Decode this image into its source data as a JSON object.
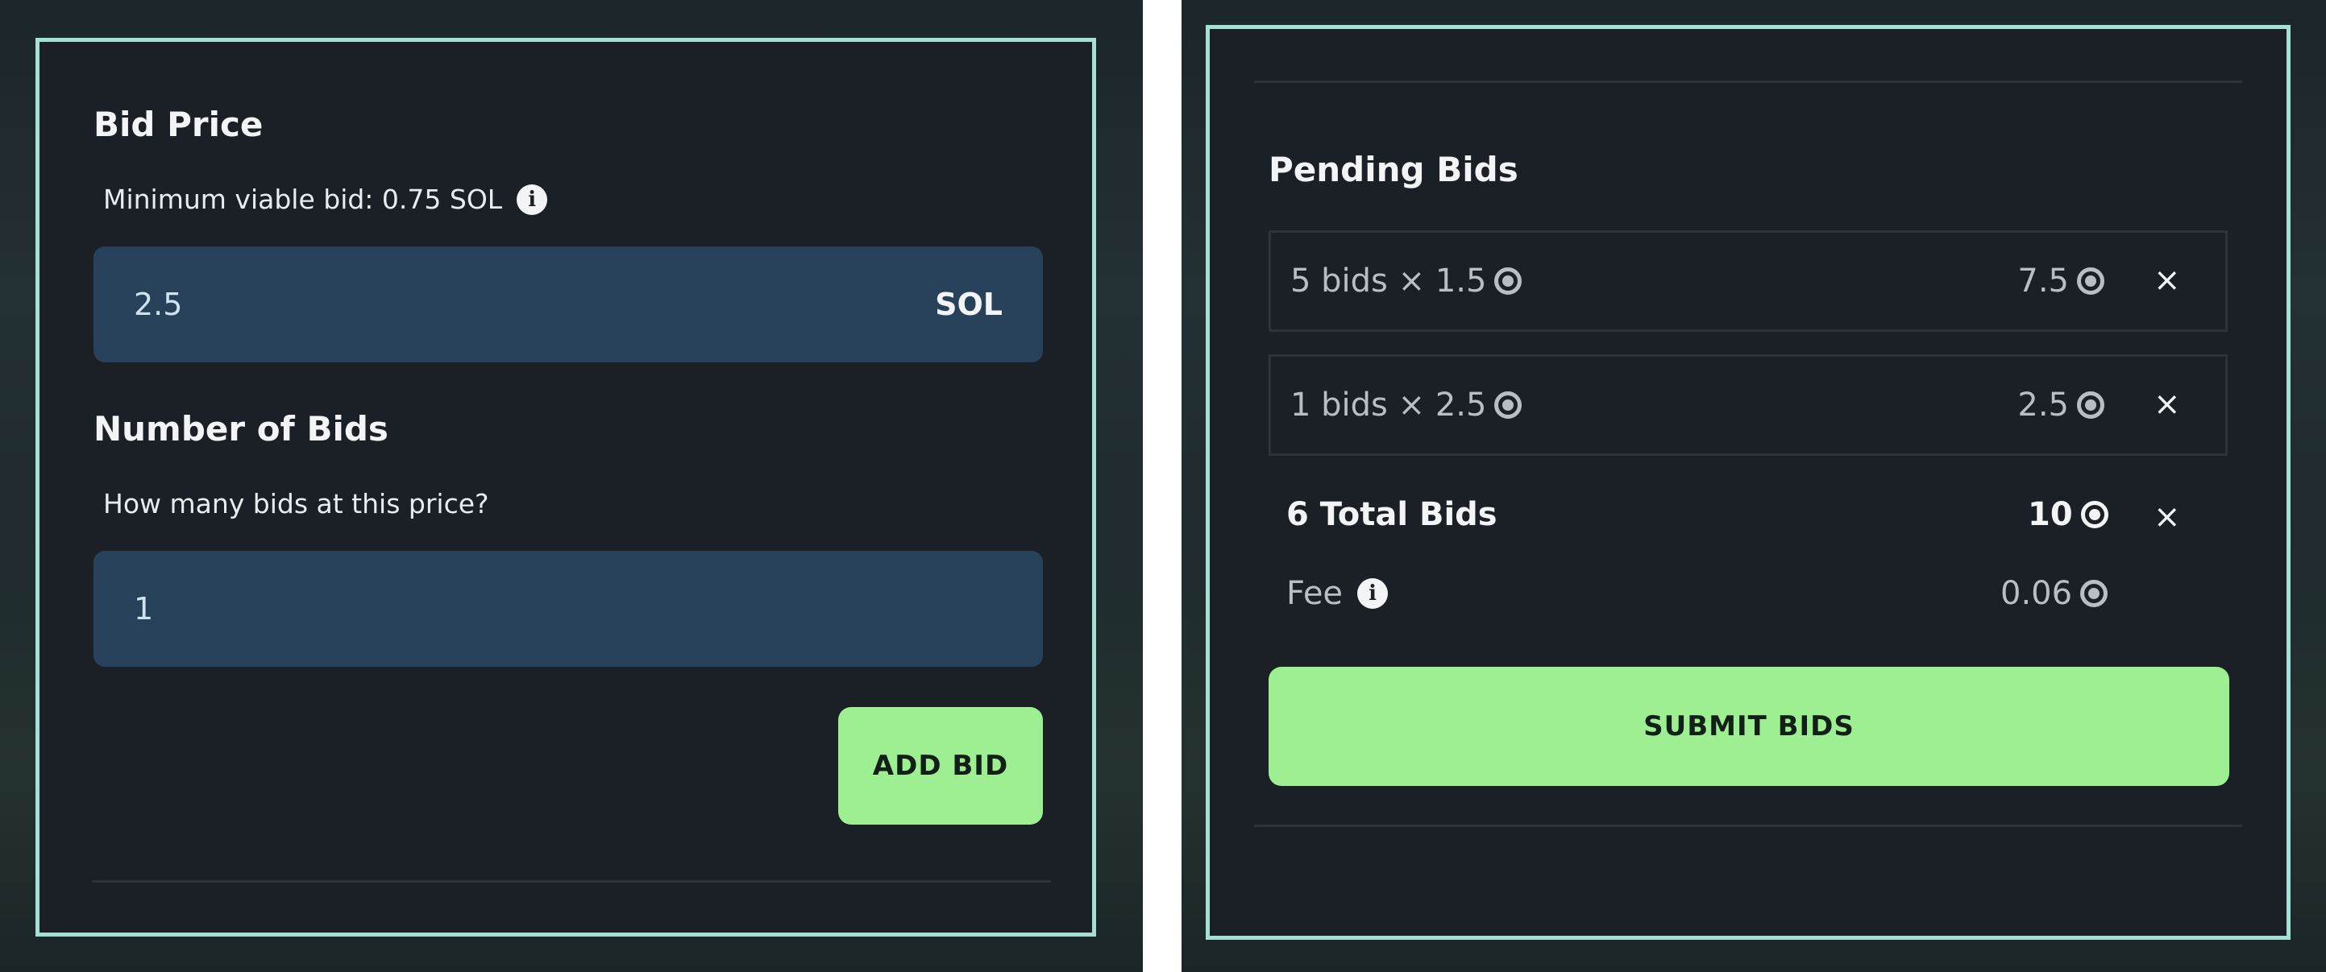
{
  "bid_form": {
    "price_heading": "Bid Price",
    "price_hint": "Minimum viable bid: 0.75 SOL",
    "price_value": "2.5",
    "price_unit": "SOL",
    "count_heading": "Number of Bids",
    "count_hint": "How many bids at this price?",
    "count_value": "1",
    "add_button": "ADD BID"
  },
  "pending": {
    "heading": "Pending Bids",
    "bids": [
      {
        "description": "5 bids × 1.5",
        "amount": "7.5",
        "remove": "×"
      },
      {
        "description": "1 bids × 2.5",
        "amount": "2.5",
        "remove": "×"
      }
    ],
    "total_label": "6 Total Bids",
    "total_amount": "10",
    "total_remove": "×",
    "fee_label": "Fee",
    "fee_amount": "0.06",
    "submit_button": "SUBMIT BIDS"
  },
  "icons": {
    "info": "info-icon",
    "currency": "sol-coin-icon",
    "remove": "close-icon"
  },
  "colors": {
    "panel_border": "#a5e0d6",
    "panel_bg": "#1b2026",
    "input_bg": "#264159",
    "accent_button": "#9def91"
  }
}
